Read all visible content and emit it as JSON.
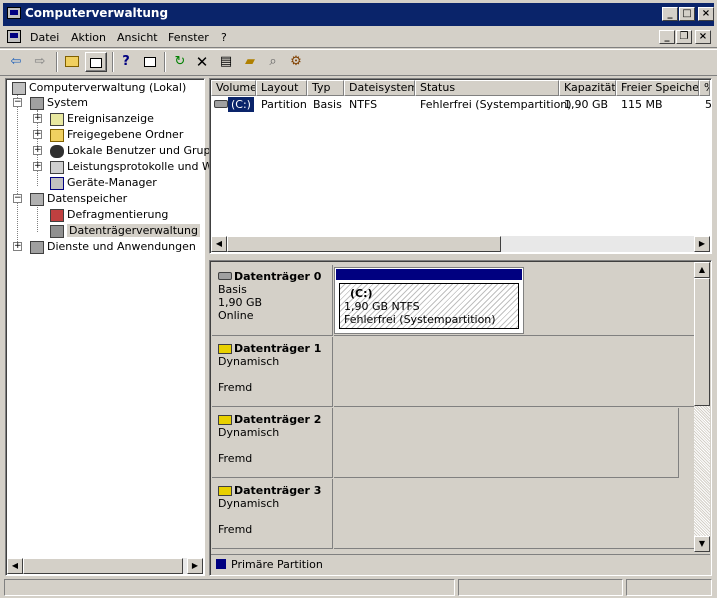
{
  "window": {
    "title": "Computerverwaltung"
  },
  "menu": [
    "Datei",
    "Aktion",
    "Ansicht",
    "Fenster",
    "?"
  ],
  "tree": {
    "root": "Computerverwaltung (Lokal)",
    "system": "System",
    "events": "Ereignisanzeige",
    "shared": "Freigegebene Ordner",
    "users": "Lokale Benutzer und Gruppe",
    "perf": "Leistungsprotokolle und War",
    "devmgr": "Geräte-Manager",
    "storage": "Datenspeicher",
    "defrag": "Defragmentierung",
    "diskmgmt": "Datenträgerverwaltung",
    "services": "Dienste und Anwendungen"
  },
  "table": {
    "columns": [
      "Volume",
      "Layout",
      "Typ",
      "Dateisystem",
      "Status",
      "Kapazität",
      "Freier Speicher",
      "%"
    ],
    "rows": [
      {
        "volume": "(C:)",
        "layout": "Partition",
        "typ": "Basis",
        "fs": "NTFS",
        "status": "Fehlerfrei (Systempartition)",
        "cap": "1,90 GB",
        "free": "115 MB",
        "pct": "5"
      }
    ]
  },
  "disks": [
    {
      "name": "Datenträger 0",
      "type": "Basis",
      "size": "1,90 GB",
      "state": "Online",
      "partition": {
        "label": "(C:)",
        "size": "1,90 GB NTFS",
        "status": "Fehlerfrei (Systempartition)"
      }
    },
    {
      "name": "Datenträger 1",
      "type": "Dynamisch",
      "size": "",
      "state": "Fremd"
    },
    {
      "name": "Datenträger 2",
      "type": "Dynamisch",
      "size": "",
      "state": "Fremd"
    },
    {
      "name": "Datenträger 3",
      "type": "Dynamisch",
      "size": "",
      "state": "Fremd"
    }
  ],
  "legend": {
    "primary": "Primäre Partition",
    "color": "#000080"
  }
}
